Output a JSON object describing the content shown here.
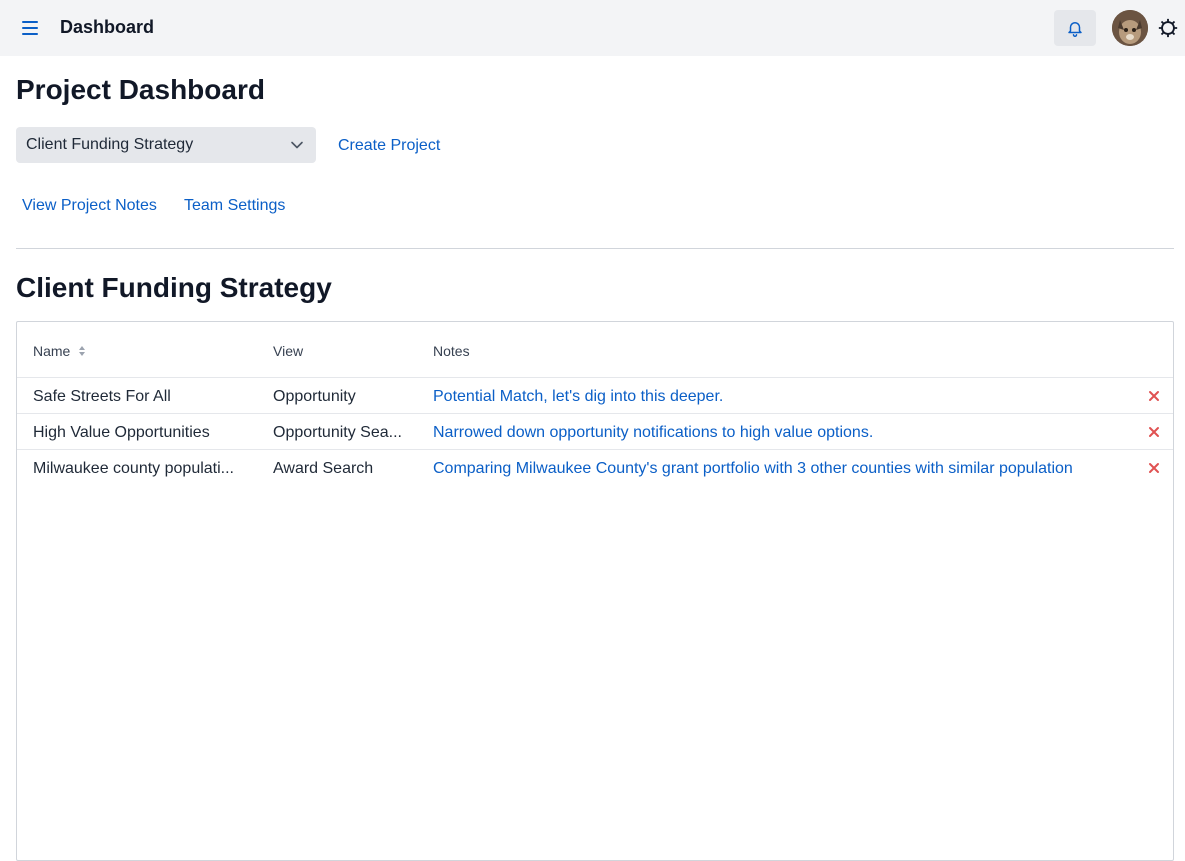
{
  "topbar": {
    "title": "Dashboard",
    "icons": {
      "menu": "menu-icon",
      "bell": "bell-icon",
      "avatar": "avatar",
      "settings": "gear-icon"
    }
  },
  "page": {
    "title": "Project Dashboard",
    "project_select": {
      "selected": "Client Funding Strategy"
    },
    "create_project_label": "Create Project",
    "links": {
      "view_notes": "View Project Notes",
      "team_settings": "Team Settings"
    }
  },
  "section": {
    "title": "Client Funding Strategy"
  },
  "table": {
    "columns": {
      "name": "Name",
      "view": "View",
      "notes": "Notes"
    },
    "rows": [
      {
        "name": "Safe Streets For All",
        "view": "Opportunity",
        "notes": "Potential Match, let's dig into this deeper."
      },
      {
        "name": "High Value Opportunities",
        "view": "Opportunity Sea...",
        "notes": "Narrowed down opportunity notifications to high value options."
      },
      {
        "name": "Milwaukee county populati...",
        "view": "Award Search",
        "notes": "Comparing Milwaukee County's grant portfolio with 3 other counties with similar population"
      }
    ]
  },
  "colors": {
    "link": "#0b5fc7",
    "delete": "#e05252",
    "topbar_bg": "#f3f4f6"
  }
}
